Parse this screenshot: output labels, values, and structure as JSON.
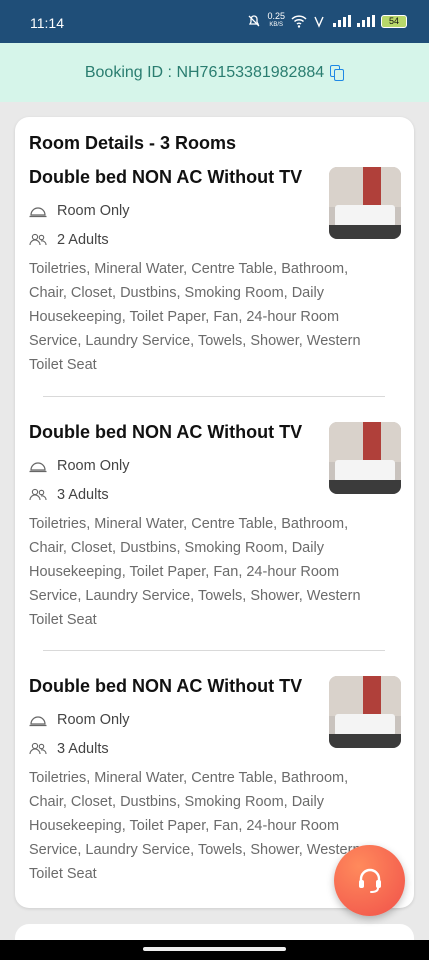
{
  "status": {
    "time": "11:14",
    "speed_value": "0.25",
    "speed_unit": "KB/S",
    "battery": "54"
  },
  "booking": {
    "label": "Booking ID : NH76153381982884",
    "icon": "copy-icon"
  },
  "card": {
    "title": "Room Details - 3 Rooms",
    "rooms": [
      {
        "name": "Double bed NON AC Without TV",
        "meal": "Room Only",
        "guests": "2 Adults",
        "amenities": "Toiletries, Mineral Water, Centre Table, Bathroom, Chair, Closet, Dustbins, Smoking Room, Daily Housekeeping, Toilet Paper, Fan, 24-hour Room Service, Laundry Service, Towels, Shower, Western Toilet Seat"
      },
      {
        "name": "Double bed NON AC Without TV",
        "meal": "Room Only",
        "guests": "3 Adults",
        "amenities": "Toiletries, Mineral Water, Centre Table, Bathroom, Chair, Closet, Dustbins, Smoking Room, Daily Housekeeping, Toilet Paper, Fan, 24-hour Room Service, Laundry Service, Towels, Shower, Western Toilet Seat"
      },
      {
        "name": "Double bed NON AC Without TV",
        "meal": "Room Only",
        "guests": "3 Adults",
        "amenities": "Toiletries, Mineral Water, Centre Table, Bathroom, Chair, Closet, Dustbins, Smoking Room, Daily Housekeeping, Toilet Paper, Fan, 24-hour Room Service, Laundry Service, Towels, Shower, Western Toilet Seat"
      }
    ]
  },
  "fab": {
    "icon": "headset-icon",
    "color": "#f0514a"
  },
  "colors": {
    "status_bar": "#1f4e78",
    "booking_bg": "#d6f5ea",
    "booking_text": "#2a7d70"
  }
}
